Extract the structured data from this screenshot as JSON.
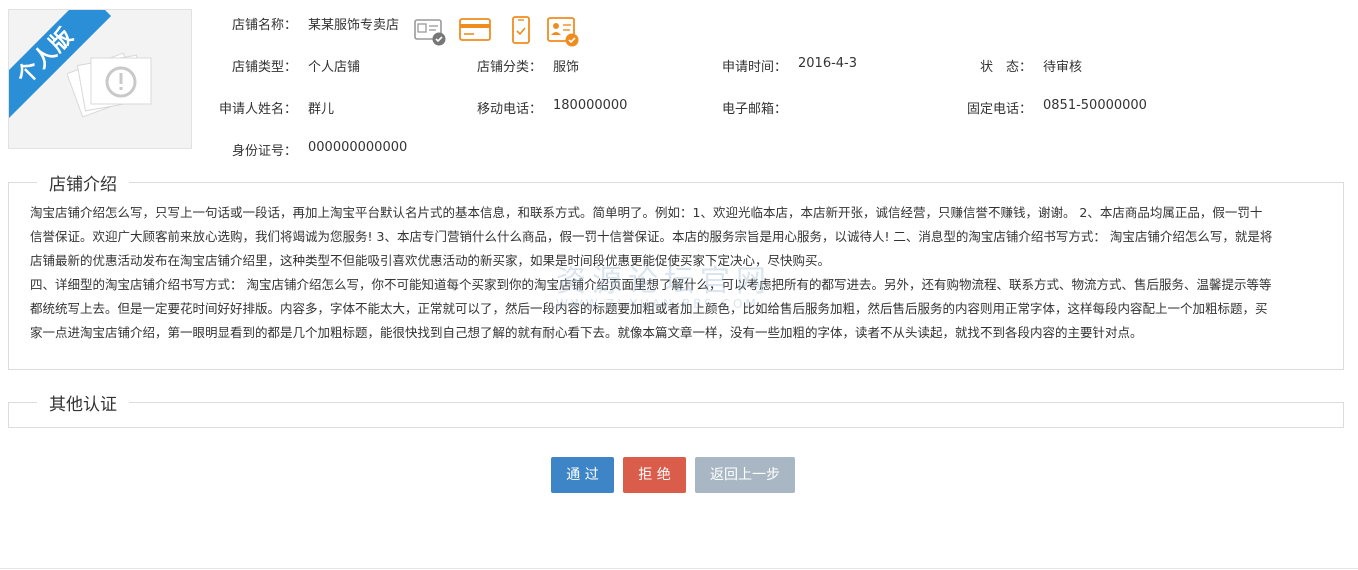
{
  "badge": {
    "text": "个人版"
  },
  "store": {
    "name_label": "店铺名称：",
    "name_value": "某某服饰专卖店",
    "type_label": "店铺类型：",
    "type_value": "个人店铺",
    "category_label": "店铺分类：",
    "category_value": "服饰",
    "apply_time_label": "申请时间：",
    "apply_time_value": "2016-4-3",
    "status_label": "状　态：",
    "status_value": "待审核",
    "applicant_label": "申请人姓名：",
    "applicant_value": "群儿",
    "mobile_label": "移动电话：",
    "mobile_value": "180000000",
    "email_label": "电子邮箱：",
    "email_value": "",
    "phone_label": "固定电话：",
    "phone_value": "0851-50000000",
    "id_label": "身份证号：",
    "id_value": "000000000000"
  },
  "cert_icons": [
    "id-card-verified-icon",
    "bank-card-icon",
    "phone-verified-icon",
    "business-license-verified-icon"
  ],
  "colors": {
    "accent": "#2a8fd6",
    "icon_orange": "#f08c1e",
    "approve": "#3d85c6",
    "reject": "#d95d4a",
    "back": "#a9b7c4"
  },
  "intro": {
    "title": "店铺介绍",
    "lines": [
      "淘宝店铺介绍怎么写，只写上一句话或一段话，再加上淘宝平台默认名片式的基本信息，和联系方式。简单明了。例如：1、欢迎光临本店，本店新开张，诚信经营，只赚信誉不赚钱，谢谢。 2、本店商品均属正品，假一罚十",
      "信誉保证。欢迎广大顾客前来放心选购，我们将竭诚为您服务! 3、本店专门营销什么什么商品，假一罚十信誉保证。本店的服务宗旨是用心服务，以诚待人! 二、消息型的淘宝店铺介绍书写方式： 淘宝店铺介绍怎么写，就是将",
      "店铺最新的优惠活动发布在淘宝店铺介绍里，这种类型不但能吸引喜欢优惠活动的新买家，如果是时间段优惠更能促使买家下定决心，尽快购买。",
      "四、详细型的淘宝店铺介绍书写方式： 淘宝店铺介绍怎么写，你不可能知道每个买家到你的淘宝店铺介绍页面里想了解什么，可以考虑把所有的都写进去。另外，还有购物流程、联系方式、物流方式、售后服务、温馨提示等等",
      "都统统写上去。但是一定要花时间好好排版。内容多，字体不能太大，正常就可以了，然后一段内容的标题要加粗或者加上颜色，比如给售后服务加粗，然后售后服务的内容则用正常字体，这样每段内容配上一个加粗标题，买",
      "家一点进淘宝店铺介绍，第一眼明显看到的都是几个加粗标题，能很快找到自己想了解的就有耐心看下去。就像本篇文章一样，没有一些加粗的字体，读者不从头读起，就找不到各段内容的主要针对点。"
    ]
  },
  "other": {
    "title": "其他认证"
  },
  "watermark": {
    "cn": "资源论坛官网",
    "en": "WWW.ZI-YUAN-BBS.COM"
  },
  "buttons": {
    "approve": "通 过",
    "reject": "拒 绝",
    "back": "返回上一步"
  }
}
